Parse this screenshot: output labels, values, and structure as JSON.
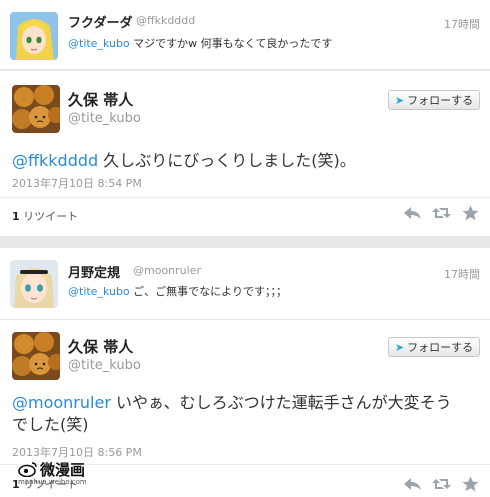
{
  "tweet1": {
    "name": "フクダーダ",
    "handle": "@ffkkdddd",
    "time": "17時間",
    "mention": "@tite_kubo",
    "text": " マジですかw 何事もなくて良かったです"
  },
  "tweet2": {
    "name": "久保 帯人",
    "handle": "@tite_kubo",
    "follow_label": "フォローする",
    "mention": "@ffkkdddd",
    "text": " 久しぶりにびっくりしました(笑)。",
    "date": "2013年7月10日 8:54 PM",
    "retweet_count": "1",
    "retweet_label": " リツイート"
  },
  "tweet3": {
    "name": "月野定規",
    "handle": "@moonruler",
    "time": "17時間",
    "mention": "@tite_kubo",
    "text": " ご、ご無事でなによりです；；；"
  },
  "tweet4": {
    "name": "久保 帯人",
    "handle": "@tite_kubo",
    "follow_label": "フォローする",
    "mention": "@moonruler",
    "text_line1": " いやぁ、むしろぶつけた運転手さんが大変そう",
    "text_line2": "でした(笑)",
    "date": "2013年7月10日 8:56 PM",
    "retweet_count": "1",
    "retweet_label": " リツイート"
  },
  "watermark": {
    "title": "微漫画",
    "url": "manhua.weibo.com"
  },
  "colors": {
    "link": "#2a8bd6",
    "twitter_bird": "#2aa9e0",
    "action_icon": "#9aa4ad"
  },
  "icons": [
    "reply-icon",
    "retweet-icon",
    "favorite-icon",
    "twitter-bird-icon"
  ]
}
